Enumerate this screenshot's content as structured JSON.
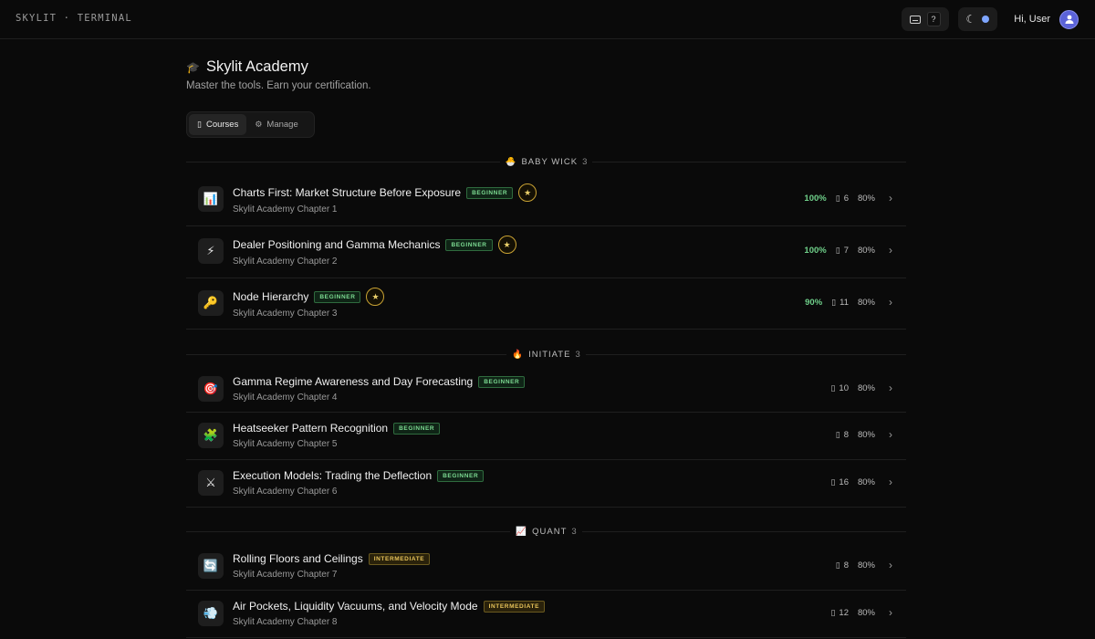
{
  "topbar": {
    "brand": "SKYLIT · TERMINAL",
    "help_key": "?",
    "greeting": "Hi, User",
    "accent": "#7fa6ff"
  },
  "header": {
    "title": "Skylit Academy",
    "subtitle": "Master the tools. Earn your certification."
  },
  "tabs": [
    {
      "label": "Courses",
      "icon": "book-icon",
      "active": true
    },
    {
      "label": "Manage",
      "icon": "gear-icon",
      "active": false
    }
  ],
  "sections": [
    {
      "emoji": "🐣",
      "label": "BABY WICK",
      "count": "3",
      "courses": [
        {
          "icon": "📊",
          "title": "Charts First: Market Structure Before Exposure",
          "level": "BEGINNER",
          "medal": "★",
          "subtitle": "Skylit Academy Chapter 1",
          "progress": "100%",
          "lessons": "6",
          "pass": "80%"
        },
        {
          "icon": "⚡",
          "title": "Dealer Positioning and Gamma Mechanics",
          "level": "BEGINNER",
          "medal": "★",
          "subtitle": "Skylit Academy Chapter 2",
          "progress": "100%",
          "lessons": "7",
          "pass": "80%"
        },
        {
          "icon": "🔑",
          "title": "Node Hierarchy",
          "level": "BEGINNER",
          "medal": "★",
          "subtitle": "Skylit Academy Chapter 3",
          "progress": "90%",
          "lessons": "11",
          "pass": "80%"
        }
      ]
    },
    {
      "emoji": "🔥",
      "label": "INITIATE",
      "count": "3",
      "courses": [
        {
          "icon": "🎯",
          "title": "Gamma Regime Awareness and Day Forecasting",
          "level": "BEGINNER",
          "subtitle": "Skylit Academy Chapter 4",
          "lessons": "10",
          "pass": "80%"
        },
        {
          "icon": "🧩",
          "title": "Heatseeker Pattern Recognition",
          "level": "BEGINNER",
          "subtitle": "Skylit Academy Chapter 5",
          "lessons": "8",
          "pass": "80%"
        },
        {
          "icon": "⚔",
          "title": "Execution Models: Trading the Deflection",
          "level": "BEGINNER",
          "subtitle": "Skylit Academy Chapter 6",
          "lessons": "16",
          "pass": "80%"
        }
      ]
    },
    {
      "emoji": "📈",
      "label": "QUANT",
      "count": "3",
      "courses": [
        {
          "icon": "🔄",
          "title": "Rolling Floors and Ceilings",
          "level": "INTERMEDIATE",
          "subtitle": "Skylit Academy Chapter 7",
          "lessons": "8",
          "pass": "80%"
        },
        {
          "icon": "💨",
          "title": "Air Pockets, Liquidity Vacuums, and Velocity Mode",
          "level": "INTERMEDIATE",
          "subtitle": "Skylit Academy Chapter 8",
          "lessons": "12",
          "pass": "80%"
        }
      ]
    }
  ]
}
